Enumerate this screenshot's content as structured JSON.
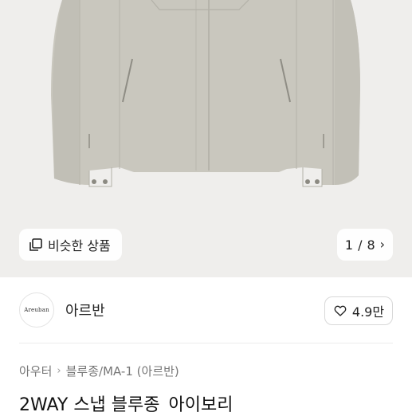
{
  "gallery": {
    "similar_label": "비슷한 상품",
    "current_page": "1",
    "page_separator": "/",
    "total_pages": "8"
  },
  "shop": {
    "logo_text": "Areuban",
    "name": "아르반",
    "likes": "4.9만"
  },
  "breadcrumb": {
    "items": [
      "아우터",
      "블루종/MA-1 (아르반)"
    ]
  },
  "product": {
    "title": "2WAY 스냅 블루종_아이보리"
  },
  "colors": {
    "hero_bg": "#efeeec",
    "jacket": "#c9c7be"
  }
}
